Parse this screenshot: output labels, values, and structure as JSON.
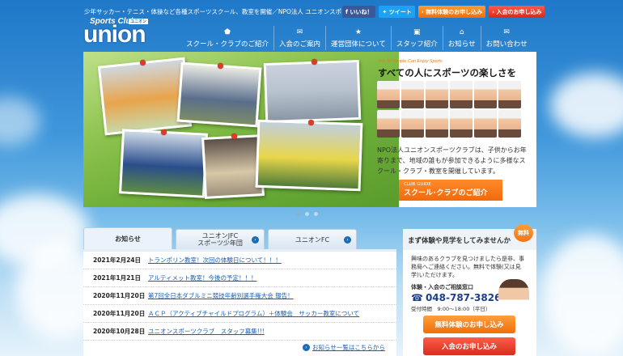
{
  "header": {
    "tagline": "少年サッカー・テニス・体操など各種スポーツスクール、教室を開催／NPO法人 ユニオンスポーツクラブ",
    "logo_small": "Sports Club",
    "logo_main": "union",
    "logo_badge": "ユニオン"
  },
  "top_buttons": {
    "like": "いいね！",
    "tweet": "ツイート",
    "trial": "無料体験のお申し込み",
    "join": "入会のお申し込み"
  },
  "nav": [
    {
      "label": "スクール・クラブのご紹介",
      "icon": "⬟"
    },
    {
      "label": "入会のご案内",
      "icon": "✉"
    },
    {
      "label": "運営団体について",
      "icon": "★"
    },
    {
      "label": "スタッフ紹介",
      "icon": "▣"
    },
    {
      "label": "お知らせ",
      "icon": "⌂"
    },
    {
      "label": "お問い合わせ",
      "icon": "✉"
    }
  ],
  "hero": {
    "en_small": "For All People Can Enjoy Sports",
    "title": "すべての人にスポーツの楽しさを",
    "description": "NPO法人ユニオンスポーツクラブは、子供からお年寄りまで、地域の誰もが参加できるように多様なスクール・クラブ・教室を開催しています。",
    "button_small": "CLUB GUIDE",
    "button_label": "スクール･クラブのご紹介"
  },
  "tabs": [
    {
      "label": "お知らせ"
    },
    {
      "label": "ユニオンJFC\nスポーツ少年団"
    },
    {
      "label": "ユニオンFC"
    }
  ],
  "news": [
    {
      "date": "2021年2月24日",
      "title": "トランポリン教室！次回の体験日について！！！"
    },
    {
      "date": "2021年1月21日",
      "title": "アルティメット教室！今後の予定！！！"
    },
    {
      "date": "2020年11月20日",
      "title": "第7回全日本ダブルミニ競技年齢別選手権大会 報告！"
    },
    {
      "date": "2020年11月20日",
      "title": "ＡＣＰ（アクティブチャイルドプログラム）＋体験会　サッカー教室について"
    },
    {
      "date": "2020年10月28日",
      "title": "ユニオンスポーツクラブ　スタッフ募集!!!"
    }
  ],
  "more_link": "お知らせ一覧はこちらから",
  "sidebar": {
    "heading": "まず体験や見学をしてみませんか",
    "free_badge": "無料",
    "description": "興味のあるクラブを見つけましたら是非、事務局へご連絡ください。無料で体験(又は見学)いただけます。",
    "contact_label": "体験・入会のご相談窓口",
    "phone": "048-787-3826",
    "hours": "受付時間　9:00～18:00（平日）",
    "trial_button": "無料体験のお申し込み",
    "join_button": "入会のお申し込み"
  },
  "colors": {
    "accent_orange": "#f26a0c",
    "accent_red": "#d72d1d",
    "link_blue": "#1a5fb4",
    "sky_blue": "#1f78c8"
  }
}
